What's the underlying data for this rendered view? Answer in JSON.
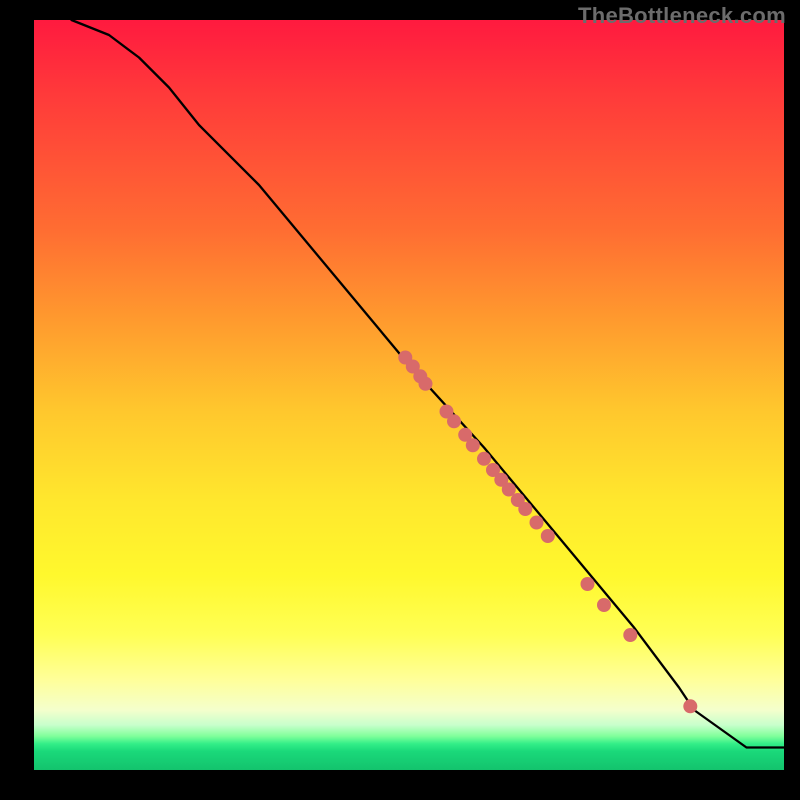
{
  "watermark": "TheBottleneck.com",
  "chart_data": {
    "type": "line",
    "title": "",
    "xlabel": "",
    "ylabel": "",
    "xlim": [
      0,
      100
    ],
    "ylim": [
      0,
      100
    ],
    "series": [
      {
        "name": "curve",
        "kind": "line",
        "x": [
          5,
          10,
          14,
          18,
          22,
          30,
          40,
          50,
          60,
          70,
          80,
          86,
          88,
          95,
          100
        ],
        "y": [
          100,
          98,
          95,
          91,
          86,
          78,
          66,
          54,
          43,
          31,
          19,
          11,
          8,
          3,
          3
        ]
      },
      {
        "name": "points",
        "kind": "scatter",
        "x": [
          49.5,
          50.5,
          51.5,
          52.2,
          55.0,
          56.0,
          57.5,
          58.5,
          60.0,
          61.2,
          62.3,
          63.3,
          64.5,
          65.5,
          67.0,
          68.5,
          73.8,
          76.0,
          79.5,
          87.5
        ],
        "y": [
          55.0,
          53.8,
          52.5,
          51.5,
          47.8,
          46.5,
          44.7,
          43.3,
          41.5,
          40.0,
          38.7,
          37.4,
          36.0,
          34.8,
          33.0,
          31.2,
          24.8,
          22.0,
          18.0,
          8.5
        ]
      }
    ],
    "colors": {
      "curve": "#000000",
      "points": "#d86a6a"
    }
  }
}
